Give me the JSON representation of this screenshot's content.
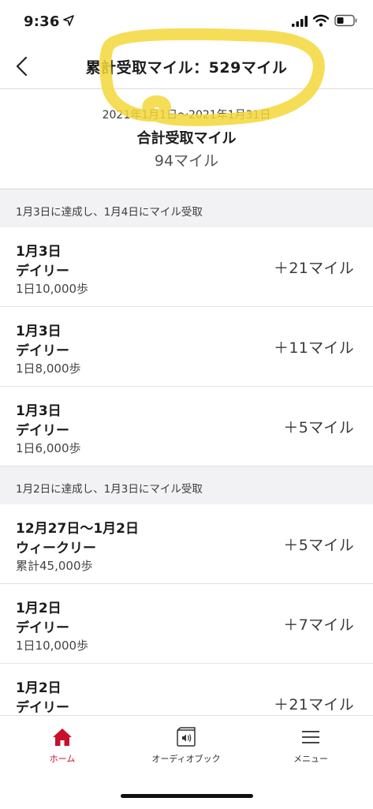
{
  "status_bar": {
    "time": "9:36"
  },
  "nav": {
    "title": "累計受取マイル：529マイル"
  },
  "summary": {
    "period": "2021年1月1日〜2021年1月31日",
    "title": "合計受取マイル",
    "value": "94マイル"
  },
  "sections": [
    {
      "header": "1月3日に達成し、1月4日にマイル受取",
      "rows": [
        {
          "date": "1月3日",
          "type": "デイリー",
          "condition": "1日10,000歩",
          "miles": "＋21マイル"
        },
        {
          "date": "1月3日",
          "type": "デイリー",
          "condition": "1日8,000歩",
          "miles": "＋11マイル"
        },
        {
          "date": "1月3日",
          "type": "デイリー",
          "condition": "1日6,000歩",
          "miles": "＋5マイル"
        }
      ]
    },
    {
      "header": "1月2日に達成し、1月3日にマイル受取",
      "rows": [
        {
          "date": "12月27日〜1月2日",
          "type": "ウィークリー",
          "condition": "累計45,000歩",
          "miles": "＋5マイル"
        },
        {
          "date": "1月2日",
          "type": "デイリー",
          "condition": "1日10,000歩",
          "miles": "＋7マイル"
        },
        {
          "date": "1月2日",
          "type": "デイリー",
          "condition": "",
          "miles": "＋21マイル"
        }
      ]
    }
  ],
  "tabs": [
    {
      "label": "ホーム",
      "icon": "home-icon",
      "active": true
    },
    {
      "label": "オーディオブック",
      "icon": "audiobook-icon",
      "active": false
    },
    {
      "label": "メニュー",
      "icon": "menu-icon",
      "active": false
    }
  ],
  "colors": {
    "accent": "#c8102e",
    "highlight": "#f5d73a"
  }
}
